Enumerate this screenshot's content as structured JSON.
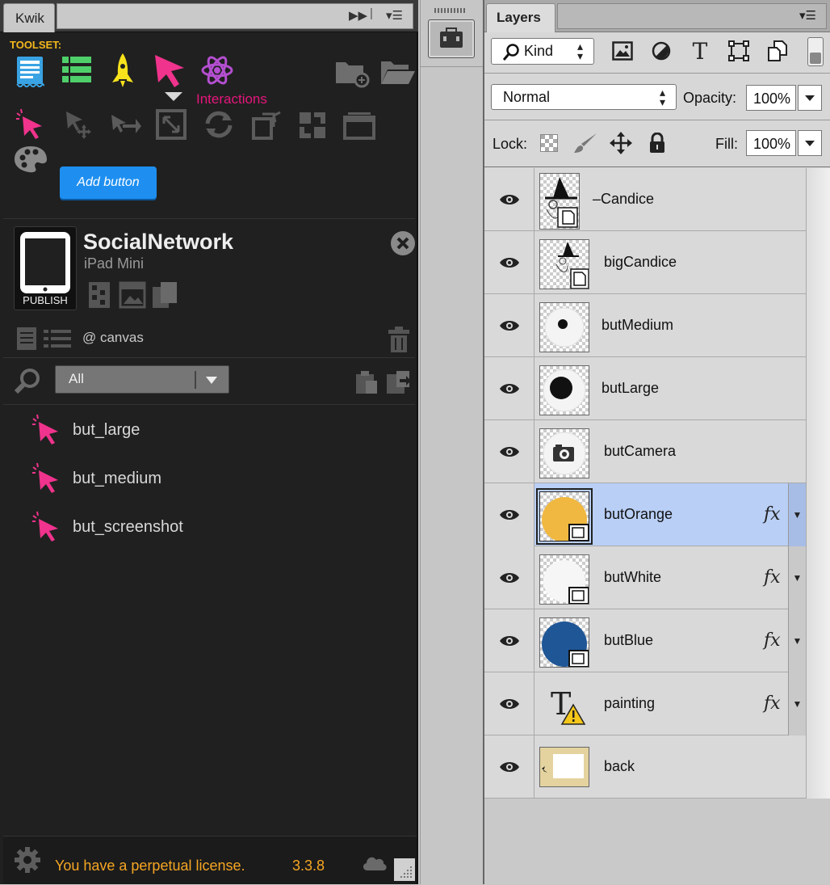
{
  "kwik": {
    "tab_label": "Kwik",
    "toolset_label": "TOOLSET:",
    "interactions_label": "Interactions",
    "add_button_label": "Add button",
    "project": {
      "name": "SocialNetwork",
      "device": "iPad Mini",
      "publish_label": "PUBLISH"
    },
    "canvas_label": "@ canvas",
    "filter_value": "All",
    "items": [
      {
        "label": "but_large"
      },
      {
        "label": "but_medium"
      },
      {
        "label": "but_screenshot"
      }
    ],
    "license_text": "You have a perpetual license.",
    "version": "3.3.8",
    "colors": {
      "accent_pink": "#e6157c",
      "accent_orange": "#f5a623",
      "button_blue": "#1e8ff0"
    }
  },
  "layers": {
    "tab_label": "Layers",
    "kind_label": "Kind",
    "blend_mode": "Normal",
    "opacity_label": "Opacity:",
    "opacity_value": "100%",
    "lock_label": "Lock:",
    "fill_label": "Fill:",
    "fill_value": "100%",
    "items": [
      {
        "name": "–Candice",
        "thumb": "witch-smart-object",
        "fx": false,
        "selected": false
      },
      {
        "name": "bigCandice",
        "thumb": "witch-smart-object",
        "fx": false,
        "selected": false
      },
      {
        "name": "butMedium",
        "thumb": "medium-dot",
        "fx": false,
        "selected": false
      },
      {
        "name": "butLarge",
        "thumb": "large-dot",
        "fx": false,
        "selected": false
      },
      {
        "name": "butCamera",
        "thumb": "camera",
        "fx": false,
        "selected": false
      },
      {
        "name": "butOrange",
        "thumb": "orange-shape",
        "fx": true,
        "fx_label": "fx",
        "selected": true
      },
      {
        "name": "butWhite",
        "thumb": "white-shape",
        "fx": true,
        "fx_label": "fx",
        "selected": false
      },
      {
        "name": "butBlue",
        "thumb": "blue-shape",
        "fx": true,
        "fx_label": "fx",
        "selected": false
      },
      {
        "name": "painting",
        "thumb": "text-warning",
        "fx": true,
        "fx_label": "fx",
        "selected": false
      },
      {
        "name": "back",
        "thumb": "background",
        "fx": false,
        "selected": false
      }
    ],
    "colors": {
      "selected_row": "#b9cff6",
      "orange": "#f0b840",
      "blue": "#1f5696"
    }
  }
}
